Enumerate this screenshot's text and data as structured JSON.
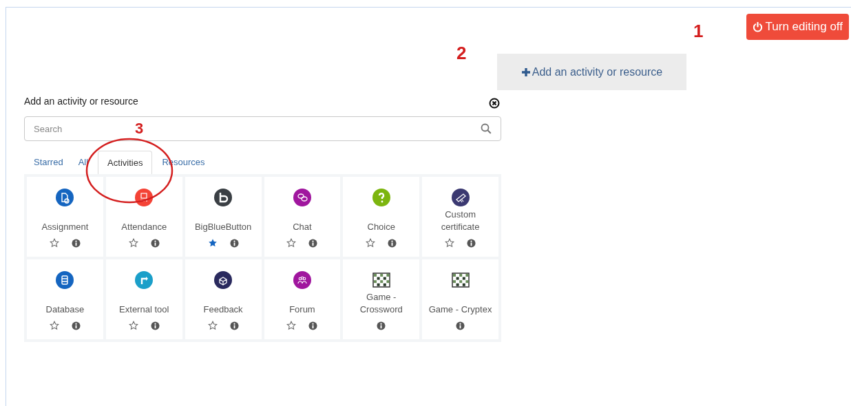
{
  "editing_button": {
    "label": "Turn editing off"
  },
  "add_activity_link": {
    "label": "Add an activity or resource"
  },
  "chooser": {
    "title": "Add an activity or resource",
    "search": {
      "placeholder": "Search"
    },
    "tabs": [
      {
        "label": "Starred",
        "selected": false
      },
      {
        "label": "All",
        "selected": false
      },
      {
        "label": "Activities",
        "selected": true
      },
      {
        "label": "Resources",
        "selected": false
      }
    ],
    "items": [
      {
        "kind": "module",
        "name": "Assignment",
        "color": "#1565c0",
        "starred": false
      },
      {
        "kind": "module",
        "name": "Attendance",
        "color": "#f44336",
        "starred": false
      },
      {
        "kind": "module",
        "name": "BigBlueButton",
        "color": "#3a3f44",
        "starred": true
      },
      {
        "kind": "module",
        "name": "Chat",
        "color": "#a0169e",
        "starred": false
      },
      {
        "kind": "module",
        "name": "Choice",
        "color": "#7cb50f",
        "starred": false
      },
      {
        "kind": "module",
        "name": "Custom certificate",
        "color": "#3b3971",
        "starred": false
      },
      {
        "kind": "module",
        "name": "Database",
        "color": "#1565c0",
        "starred": false
      },
      {
        "kind": "module",
        "name": "External tool",
        "color": "#1b9fc9",
        "starred": false
      },
      {
        "kind": "module",
        "name": "Feedback",
        "color": "#2a2a5e",
        "starred": false
      },
      {
        "kind": "module",
        "name": "Forum",
        "color": "#a0169e",
        "starred": false
      },
      {
        "kind": "game",
        "name": "Game - Crossword"
      },
      {
        "kind": "game",
        "name": "Game - Cryptex"
      }
    ]
  },
  "annotations": [
    {
      "label": "1"
    },
    {
      "label": "2"
    },
    {
      "label": "3"
    }
  ]
}
